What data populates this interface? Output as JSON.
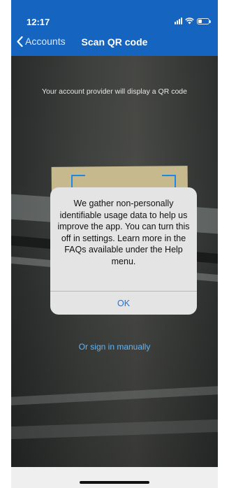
{
  "status_bar": {
    "time": "12:17"
  },
  "nav": {
    "back_label": "Accounts",
    "title": "Scan QR code"
  },
  "scanner": {
    "instruction": "Your account provider will display a QR code"
  },
  "alert": {
    "message": "We gather non-personally identifiable usage data to help us improve the app. You can turn this off in settings. Learn more in the FAQs available under the Help menu.",
    "ok_label": "OK"
  },
  "manual_sign_in": "Or sign in manually",
  "colors": {
    "header": "#1565c0",
    "accent": "#1e88e5",
    "link": "#64b5f6"
  }
}
